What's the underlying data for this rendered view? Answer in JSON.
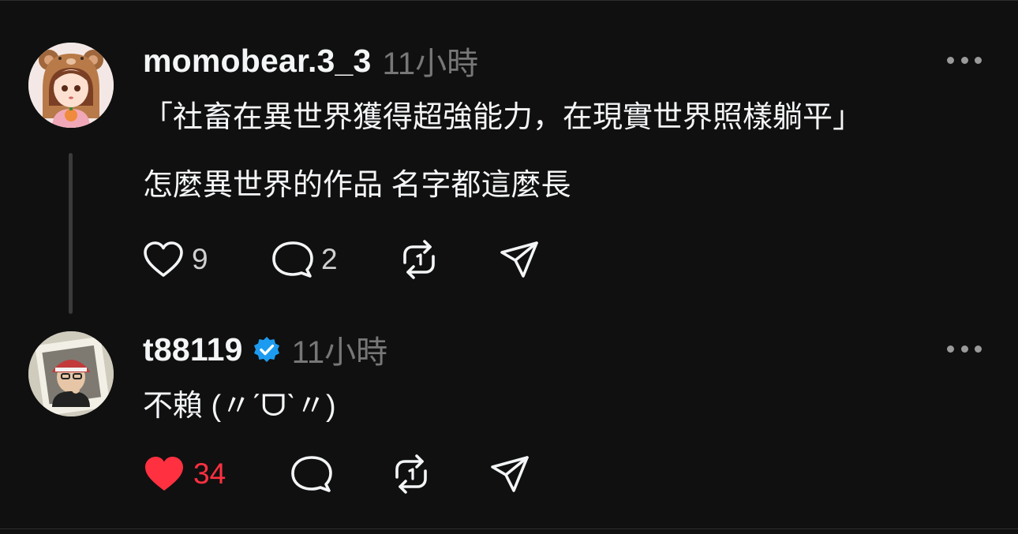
{
  "posts": [
    {
      "username": "momobear.3_3",
      "time": "11小時",
      "lines": [
        "「社畜在異世界獲得超強能力，在現實世界照樣躺平」",
        "怎麼異世界的作品 名字都這麼長"
      ],
      "likes": "9",
      "comments": "2",
      "liked": false,
      "verified": false
    },
    {
      "username": "t88119",
      "time": "11小時",
      "lines": [
        "不賴 (〃ˊᗜˋ〃)"
      ],
      "likes": "34",
      "comments": "",
      "liked": true,
      "verified": true
    }
  ],
  "colors": {
    "background": "#101010",
    "text": "#f3f5f7",
    "muted": "#777777",
    "like_red": "#ff3040",
    "verified_blue": "#1d9bf0"
  },
  "icons": [
    "heart-icon",
    "comment-icon",
    "repost-icon",
    "share-icon",
    "more-icon",
    "verified-icon"
  ]
}
